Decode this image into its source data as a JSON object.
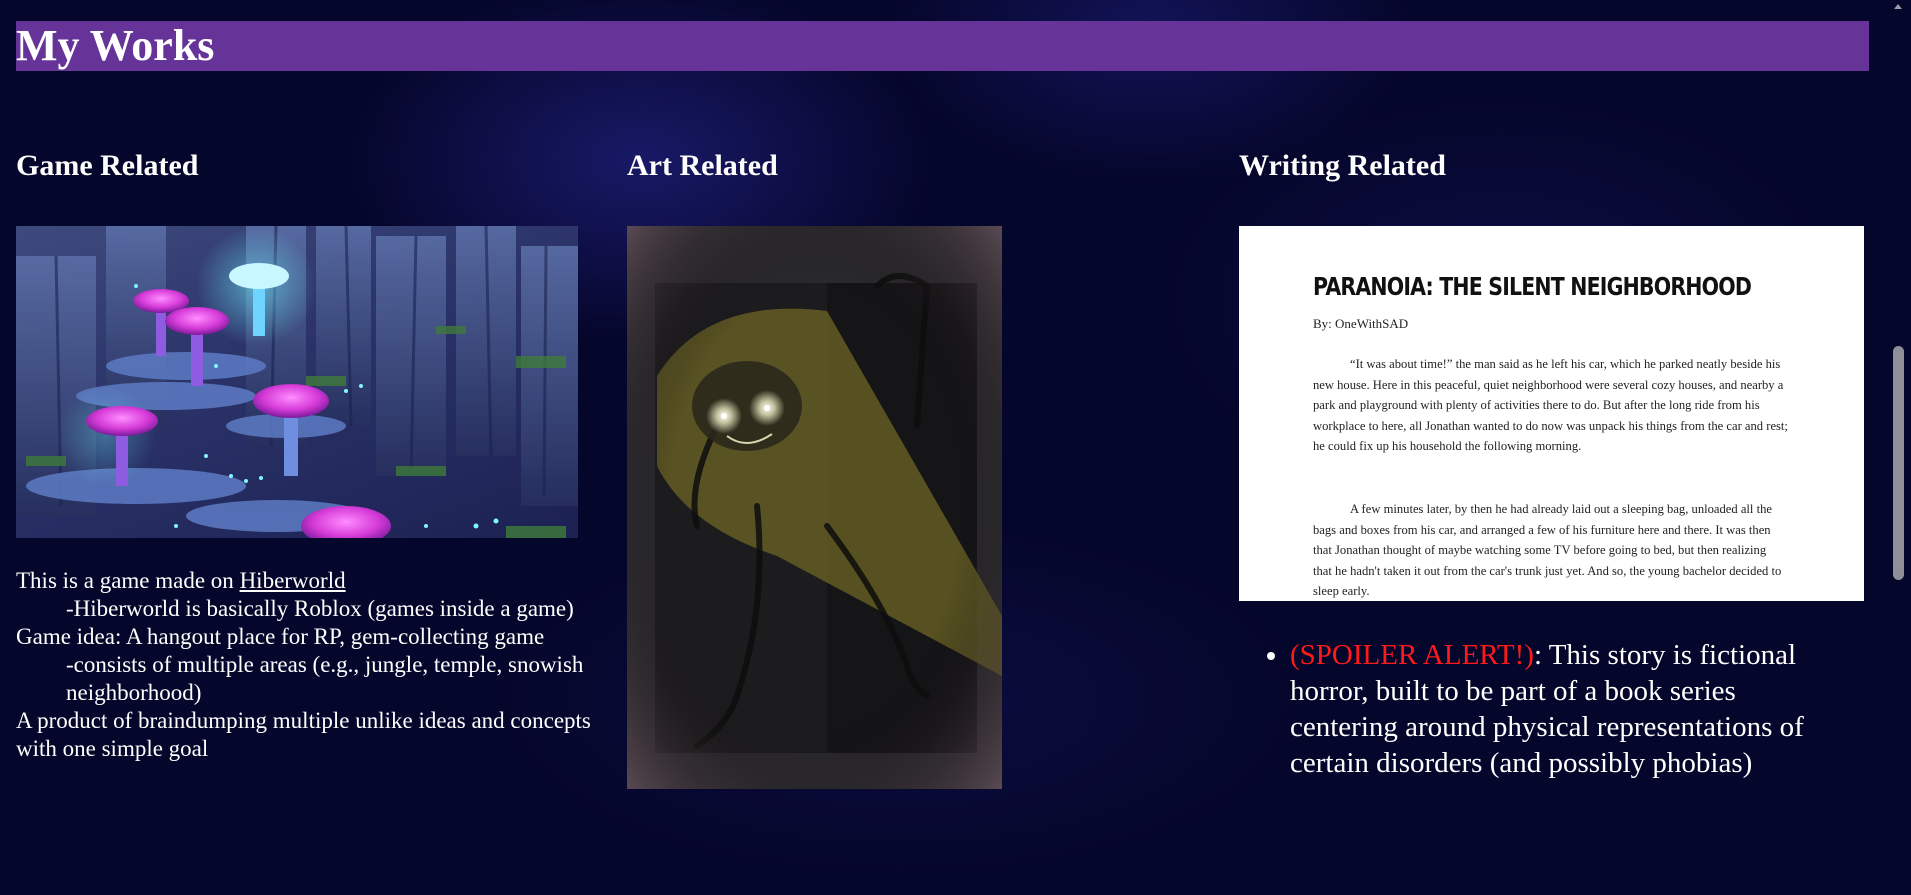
{
  "header": {
    "title": "My Works"
  },
  "columns": {
    "game": {
      "heading": "Game Related",
      "lines": [
        {
          "text": "This is a game made on ",
          "link": "Hiberworld"
        },
        {
          "text": "-Hiberworld is basically Roblox (games inside a game)"
        },
        {
          "text": "Game idea: A hangout place for RP, gem-collecting game"
        },
        {
          "text": "-consists of multiple areas (e.g., jungle, temple, snowish neighborhood)"
        },
        {
          "text": "A product of braindumping multiple unlike ideas and concepts with one simple goal"
        }
      ]
    },
    "art": {
      "heading": "Art Related"
    },
    "writing": {
      "heading": "Writing Related",
      "document": {
        "title": "PARANOIA: THE SILENT NEIGHBORHOOD",
        "byline": "By: OneWithSAD",
        "paragraphs": [
          "“It was about time!” the man said as he left his car, which he parked neatly beside his new house. Here in this peaceful, quiet neighborhood were several cozy houses, and nearby a park and playground with plenty of activities there to do. But after the long ride from his workplace to here, all Jonathan wanted to do now was unpack his things from the car and rest; he could fix up his household the following morning.",
          "A few minutes later, by then he had already laid out a sleeping bag, unloaded all the bags and boxes from his car, and arranged a few of his furniture here and there. It was then that Jonathan thought of maybe watching some TV before going to bed, but then realizing that he hadn't taken it out from the car's trunk just yet. And so, the young bachelor decided to sleep early."
        ]
      },
      "bullet": {
        "spoiler": "(SPOILER ALERT!)",
        "text": ": This story is fictional horror, built to be part of a book series centering around physical representations of certain disorders (and possibly phobias)"
      }
    }
  },
  "colors": {
    "title_bar": "#663399",
    "background": "#05062b",
    "spoiler": "#ff1a1a"
  }
}
